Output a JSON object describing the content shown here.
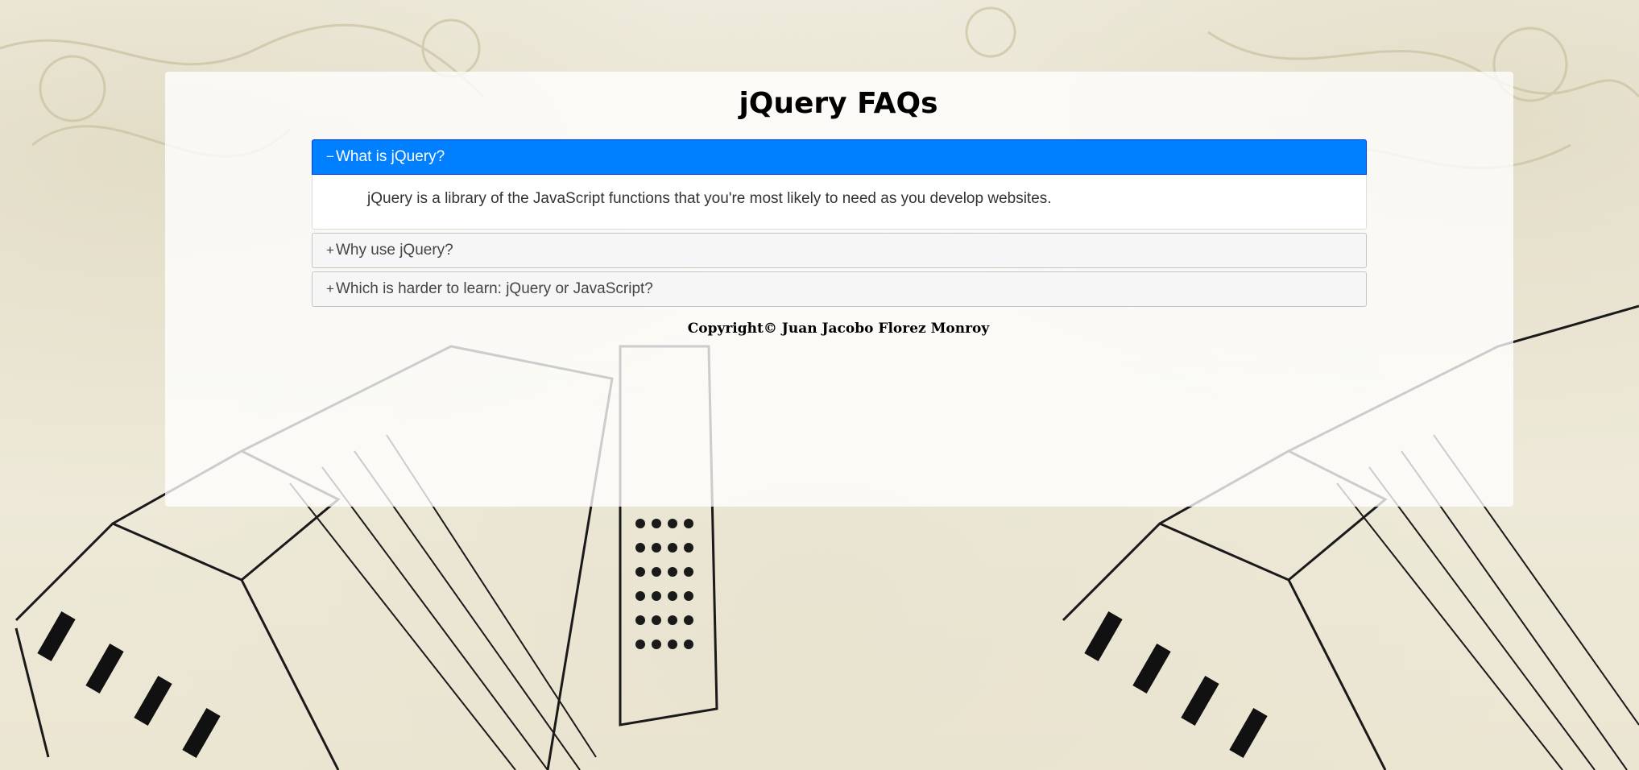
{
  "page": {
    "title": "jQuery FAQs",
    "copyright": "Copyright© Juan Jacobo Florez Monroy"
  },
  "faq": {
    "items": [
      {
        "question": "What is jQuery?",
        "icon": "−",
        "icon_name": "minus-icon",
        "expanded": true,
        "answer": "jQuery is a library of the JavaScript functions that you're most likely to need as you develop websites."
      },
      {
        "question": "Why use jQuery?",
        "icon": "+",
        "icon_name": "plus-icon",
        "expanded": false
      },
      {
        "question": "Which is harder to learn: jQuery or JavaScript?",
        "icon": "+",
        "icon_name": "plus-icon",
        "expanded": false
      }
    ]
  },
  "colors": {
    "active_header": "#007fff",
    "inactive_header": "#f6f6f6",
    "panel_background": "rgba(255,255,255,0.78)"
  }
}
